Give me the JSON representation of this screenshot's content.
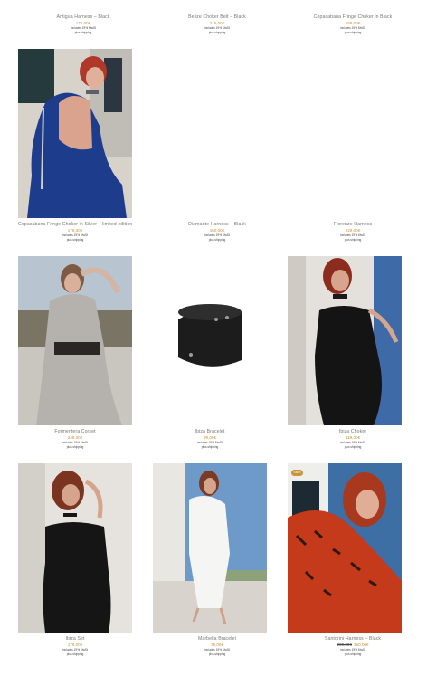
{
  "products": [
    {
      "title": "Antigua Harness – Black",
      "price": "175,00€",
      "tax": "includes 19% MwSt",
      "shipping": "plus shipping"
    },
    {
      "title": "Belize Choker Belt – Black",
      "price": "215,00€",
      "tax": "includes 19% MwSt",
      "shipping": "plus shipping"
    },
    {
      "title": "Copacabana Fringe Choker in Black",
      "price": "159,00€",
      "tax": "includes 19% MwSt",
      "shipping": "plus shipping"
    },
    {
      "title": "Copacabana Fringe Choker in Silver – limited edition",
      "price": "179,00€",
      "tax": "includes 19% MwSt",
      "shipping": "plus shipping"
    },
    {
      "title": "Diamante Harness – Black",
      "price": "160,00€",
      "tax": "includes 19% MwSt",
      "shipping": "plus shipping"
    },
    {
      "title": "Florenze Harness",
      "price": "229,00€",
      "tax": "includes 19% MwSt",
      "shipping": "plus shipping"
    },
    {
      "title": "Formentera Corset",
      "price": "249,00€",
      "tax": "includes 19% MwSt",
      "shipping": "plus shipping"
    },
    {
      "title": "Ibiza Bracelet",
      "price": "99,00€",
      "tax": "includes 19% MwSt",
      "shipping": "plus shipping"
    },
    {
      "title": "Ibiza Choker",
      "price": "119,00€",
      "tax": "includes 19% MwSt",
      "shipping": "plus shipping"
    },
    {
      "title": "Ibiza Set",
      "price": "179,00€",
      "tax": "includes 19% MwSt",
      "shipping": "plus shipping"
    },
    {
      "title": "Marbella Bracelet",
      "price": "79,00€",
      "tax": "includes 19% MwSt",
      "shipping": "plus shipping"
    },
    {
      "title": "Santorini Harness – Black",
      "price_old": "200,00€",
      "price": "150,00€",
      "tax": "includes 19% MwSt",
      "shipping": "plus shipping",
      "badge": "Sale!"
    }
  ],
  "colors": {
    "price": "#c8933a",
    "sale_badge": "#c8933a"
  }
}
